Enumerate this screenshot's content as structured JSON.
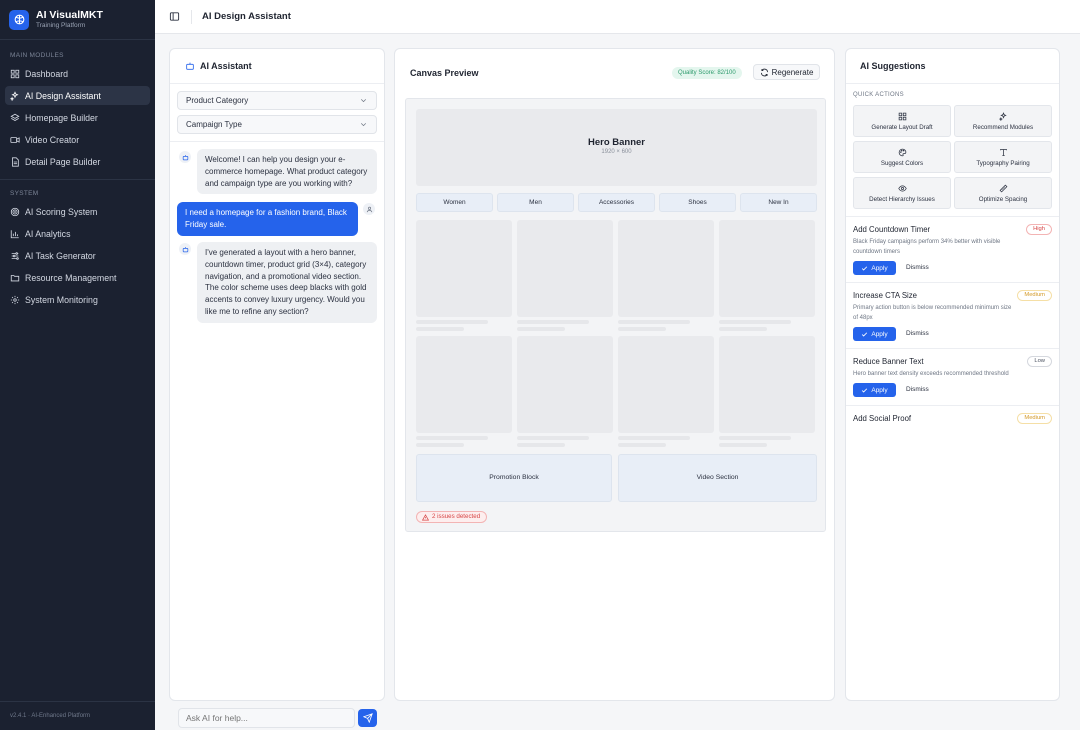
{
  "brand": {
    "name": "AI VisualMKT",
    "subtitle": "Training Platform"
  },
  "sidebar": {
    "main_label": "MAIN MODULES",
    "main_items": [
      {
        "label": "Dashboard",
        "icon": "grid-icon"
      },
      {
        "label": "AI Design Assistant",
        "icon": "sparkles-icon",
        "active": true
      },
      {
        "label": "Homepage Builder",
        "icon": "layers-icon"
      },
      {
        "label": "Video Creator",
        "icon": "video-icon"
      },
      {
        "label": "Detail Page Builder",
        "icon": "file-icon"
      }
    ],
    "system_label": "SYSTEM",
    "system_items": [
      {
        "label": "AI Scoring System",
        "icon": "target-icon"
      },
      {
        "label": "AI Analytics",
        "icon": "bar-chart-icon"
      },
      {
        "label": "AI Task Generator",
        "icon": "sliders-icon"
      },
      {
        "label": "Resource Management",
        "icon": "folder-icon"
      },
      {
        "label": "System Monitoring",
        "icon": "gear-icon"
      }
    ],
    "version": "v2.4.1 · AI-Enhanced Platform"
  },
  "header": {
    "title": "AI Design Assistant"
  },
  "assistant": {
    "title": "AI Assistant",
    "select_category": "Product Category",
    "select_campaign": "Campaign Type",
    "messages": [
      {
        "role": "ai",
        "text": "Welcome! I can help you design your e-commerce homepage. What product category and campaign type are you working with?"
      },
      {
        "role": "user",
        "text": "I need a homepage for a fashion brand, Black Friday sale."
      },
      {
        "role": "ai",
        "text": "I've generated a layout with a hero banner, countdown timer, product grid (3×4), category navigation, and a promotional video section. The color scheme uses deep blacks with gold accents to convey luxury urgency. Would you like me to refine any section?"
      }
    ],
    "input_placeholder": "Ask AI for help..."
  },
  "canvas": {
    "title": "Canvas Preview",
    "quality": "Quality Score: 82/100",
    "regenerate": "Regenerate",
    "hero_title": "Hero Banner",
    "hero_size": "1920 × 600",
    "categories": [
      "Women",
      "Men",
      "Accessories",
      "Shoes",
      "New In"
    ],
    "promo_block": "Promotion Block",
    "video_section": "Video Section",
    "issues": "2 issues detected"
  },
  "suggestions": {
    "title": "AI Suggestions",
    "quick_actions_label": "QUICK ACTIONS",
    "quick_actions": [
      {
        "label": "Generate Layout Draft",
        "icon": "grid-icon"
      },
      {
        "label": "Recommend Modules",
        "icon": "sparkles-icon"
      },
      {
        "label": "Suggest Colors",
        "icon": "palette-icon"
      },
      {
        "label": "Typography Pairing",
        "icon": "type-icon"
      },
      {
        "label": "Detect Hierarchy Issues",
        "icon": "eye-icon"
      },
      {
        "label": "Optimize Spacing",
        "icon": "ruler-icon"
      }
    ],
    "items": [
      {
        "title": "Add Countdown Timer",
        "desc": "Black Friday campaigns perform 34% better with visible countdown timers",
        "priority": "High",
        "level": "high"
      },
      {
        "title": "Increase CTA Size",
        "desc": "Primary action button is below recommended minimum size of 48px",
        "priority": "Medium",
        "level": "medium"
      },
      {
        "title": "Reduce Banner Text",
        "desc": "Hero banner text density exceeds recommended threshold",
        "priority": "Low",
        "level": "low"
      },
      {
        "title": "Add Social Proof",
        "desc": "",
        "priority": "Medium",
        "level": "medium"
      }
    ],
    "apply_label": "Apply",
    "dismiss_label": "Dismiss"
  }
}
